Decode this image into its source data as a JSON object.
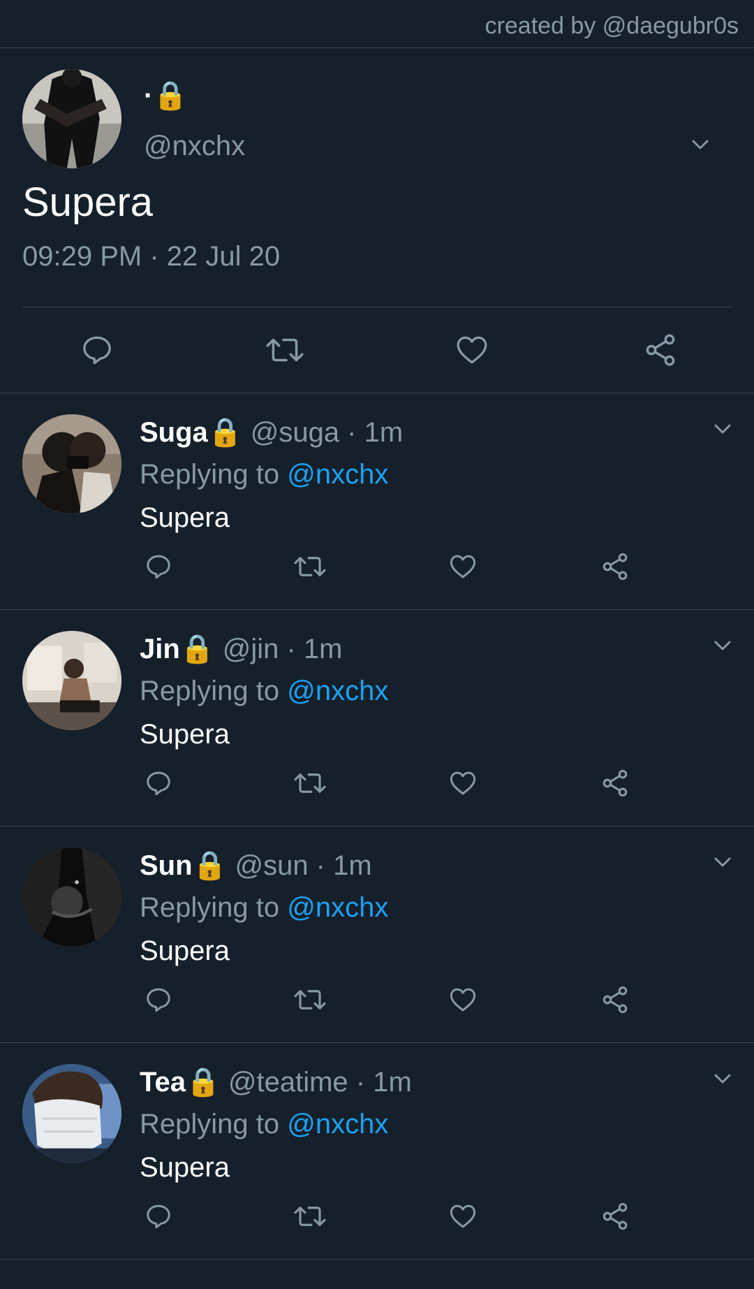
{
  "header": {
    "credit": "created by @daegubr0s"
  },
  "main_tweet": {
    "name": "·🔒",
    "handle": "@nxchx",
    "text": "Supera",
    "timestamp": "09:29 PM · 22 Jul 20"
  },
  "replies": [
    {
      "name": "Suga🔒",
      "meta": " @suga · 1m",
      "replying_label": "Replying to ",
      "replying_to": "@nxchx",
      "text": "Supera"
    },
    {
      "name": "Jin🔒",
      "meta": " @jin · 1m",
      "replying_label": "Replying to ",
      "replying_to": "@nxchx",
      "text": "Supera"
    },
    {
      "name": "Sun🔒",
      "meta": " @sun · 1m",
      "replying_label": "Replying to ",
      "replying_to": "@nxchx",
      "text": "Supera"
    },
    {
      "name": "Tea🔒",
      "meta": " @teatime · 1m",
      "replying_label": "Replying to ",
      "replying_to": "@nxchx",
      "text": "Supera"
    }
  ],
  "icons": {
    "reply": "reply-icon",
    "retweet": "retweet-icon",
    "like": "heart-icon",
    "share": "share-icon",
    "menu": "chevron-down-icon"
  },
  "colors": {
    "background": "#15202b",
    "divider": "#38444d",
    "secondary_text": "#8899a6",
    "accent": "#1da1f2",
    "lock": "#f5b700"
  }
}
